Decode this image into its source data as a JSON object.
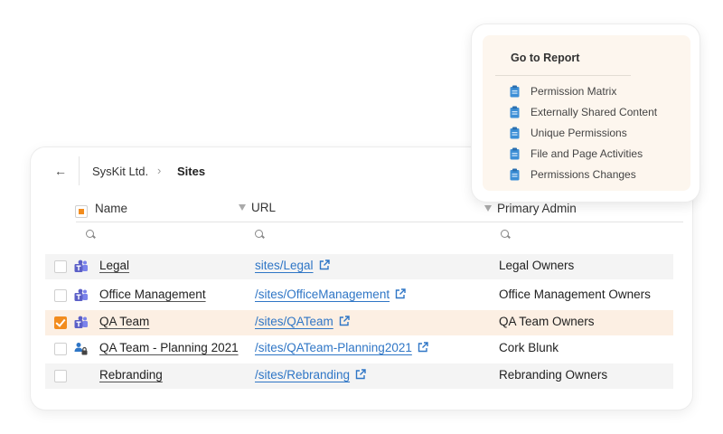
{
  "breadcrumb": {
    "back_glyph": "←",
    "root": "SysKit Ltd.",
    "separator": "›",
    "current": "Sites"
  },
  "columns": {
    "name": "Name",
    "url": "URL",
    "admin": "Primary Admin"
  },
  "rows": [
    {
      "name": "Legal",
      "url": "sites/Legal",
      "admin": "Legal Owners",
      "icon": "teams-icon",
      "selected": false
    },
    {
      "name": "Office Management",
      "url": "/sites/OfficeManagement",
      "admin": "Office Management Owners",
      "icon": "teams-icon",
      "selected": false
    },
    {
      "name": "QA Team",
      "url": "/sites/QATeam",
      "admin": "QA Team Owners",
      "icon": "teams-icon",
      "selected": true
    },
    {
      "name": "QA Team - Planning 2021",
      "url": "/sites/QATeam-Planning2021",
      "admin": "Cork Blunk",
      "icon": "private-group-icon",
      "selected": false
    },
    {
      "name": "Rebranding",
      "url": "/sites/Rebranding",
      "admin": "Rebranding Owners",
      "icon": "",
      "selected": false
    }
  ],
  "report": {
    "title": "Go to Report",
    "items": [
      "Permission Matrix",
      "Externally Shared Content",
      "Unique Permissions",
      "File and Page Activities",
      "Permissions Changes"
    ]
  },
  "colors": {
    "accent": "#f28c1e",
    "link": "#2f76c6",
    "teams": "#5b5fc7",
    "selected_row": "#fcefe3",
    "popup_bg": "#fdf6ee"
  }
}
